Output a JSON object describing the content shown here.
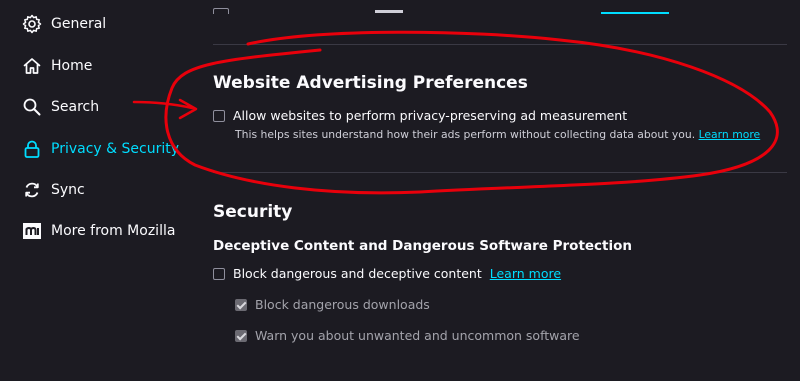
{
  "sidebar": {
    "items": [
      {
        "label": "General",
        "icon": "gear-icon"
      },
      {
        "label": "Home",
        "icon": "home-icon"
      },
      {
        "label": "Search",
        "icon": "search-icon"
      },
      {
        "label": "Privacy & Security",
        "icon": "lock-icon",
        "selected": true
      },
      {
        "label": "Sync",
        "icon": "sync-icon"
      },
      {
        "label": "More from Mozilla",
        "icon": "mozilla-icon"
      }
    ]
  },
  "advertising": {
    "heading": "Website Advertising Preferences",
    "checkbox_label": "Allow websites to perform privacy-preserving ad measurement",
    "checked": false,
    "description": "This helps sites understand how their ads perform without collecting data about you.",
    "learn_more": "Learn more"
  },
  "security": {
    "heading": "Security",
    "subheading": "Deceptive Content and Dangerous Software Protection",
    "block_label": "Block dangerous and deceptive content",
    "block_checked": false,
    "learn_more": "Learn more",
    "sub_options": [
      {
        "label": "Block dangerous downloads",
        "checked": true,
        "disabled": true
      },
      {
        "label": "Warn you about unwanted and uncommon software",
        "checked": true,
        "disabled": true
      }
    ]
  },
  "colors": {
    "background": "#1c1b22",
    "accent": "#00ddff",
    "annotation": "#e8000b"
  }
}
